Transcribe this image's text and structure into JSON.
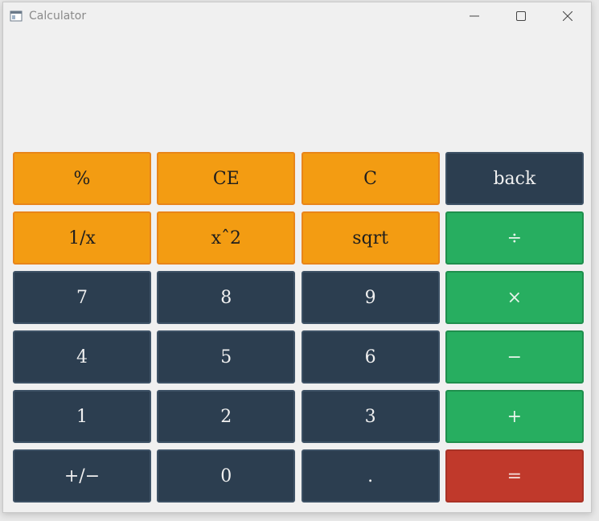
{
  "window": {
    "title": "Calculator",
    "minimize_icon": "minimize-icon",
    "maximize_icon": "maximize-icon",
    "close_icon": "close-icon"
  },
  "display": {
    "value": ""
  },
  "colors": {
    "operator_orange": "#f39c12",
    "digit_dark": "#2c3e50",
    "arith_green": "#27ae60",
    "equals_red": "#c0392b"
  },
  "keys": [
    {
      "label": "%",
      "style": "orange",
      "name": "percent-button"
    },
    {
      "label": "CE",
      "style": "orange",
      "name": "clear-entry-button"
    },
    {
      "label": "C",
      "style": "orange",
      "name": "clear-button"
    },
    {
      "label": "back",
      "style": "dark",
      "name": "backspace-button"
    },
    {
      "label": "1/x",
      "style": "orange",
      "name": "reciprocal-button"
    },
    {
      "label": "xˆ2",
      "style": "orange",
      "name": "square-button"
    },
    {
      "label": "sqrt",
      "style": "orange",
      "name": "sqrt-button"
    },
    {
      "label": "÷",
      "style": "green",
      "name": "divide-button"
    },
    {
      "label": "7",
      "style": "dark",
      "name": "digit-7-button"
    },
    {
      "label": "8",
      "style": "dark",
      "name": "digit-8-button"
    },
    {
      "label": "9",
      "style": "dark",
      "name": "digit-9-button"
    },
    {
      "label": "×",
      "style": "green",
      "name": "multiply-button"
    },
    {
      "label": "4",
      "style": "dark",
      "name": "digit-4-button"
    },
    {
      "label": "5",
      "style": "dark",
      "name": "digit-5-button"
    },
    {
      "label": "6",
      "style": "dark",
      "name": "digit-6-button"
    },
    {
      "label": "−",
      "style": "green",
      "name": "subtract-button"
    },
    {
      "label": "1",
      "style": "dark",
      "name": "digit-1-button"
    },
    {
      "label": "2",
      "style": "dark",
      "name": "digit-2-button"
    },
    {
      "label": "3",
      "style": "dark",
      "name": "digit-3-button"
    },
    {
      "label": "+",
      "style": "green",
      "name": "add-button"
    },
    {
      "label": "+/−",
      "style": "dark",
      "name": "negate-button"
    },
    {
      "label": "0",
      "style": "dark",
      "name": "digit-0-button"
    },
    {
      "label": ".",
      "style": "dark",
      "name": "decimal-button"
    },
    {
      "label": "=",
      "style": "red",
      "name": "equals-button"
    }
  ]
}
